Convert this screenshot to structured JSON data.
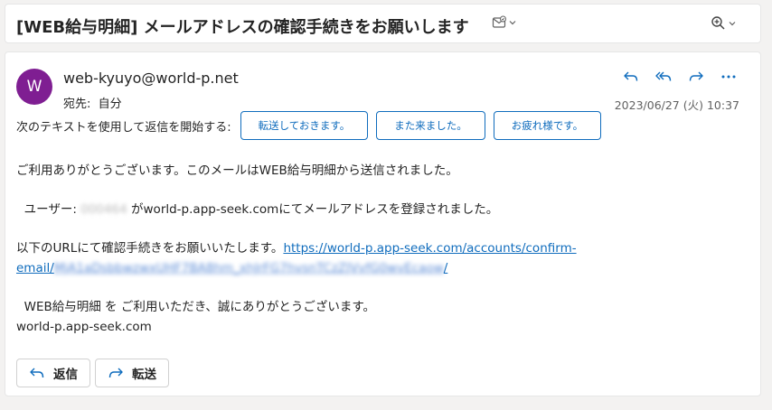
{
  "subject": {
    "title": "[WEB給与明細] メールアドレスの確認手続きをお願いします",
    "icons": [
      "mail-check-icon",
      "zoom-icon"
    ]
  },
  "message": {
    "avatar_letter": "W",
    "sender": "web-kyuyo@world-p.net",
    "to_label": "宛先:",
    "to_value": "自分",
    "date": "2023/06/27 (火) 10:37",
    "actions": [
      "reply-icon",
      "reply-all-icon",
      "forward-icon",
      "more-icon"
    ],
    "suggest_label": "次のテキストを使用して返信を開始する:",
    "suggestions": [
      "転送しておきます。",
      "また来ました。",
      "お疲れ様です。"
    ]
  },
  "body": {
    "line1": "ご利用ありがとうございます。このメールはWEB給与明細から送信されました。",
    "user_prefix": "ユーザー:",
    "user_id": "000464",
    "user_suffix": "がworld-p.app-seek.comにてメールアドレスを登録されました。",
    "url_prefix": "以下のURLにて確認手続きをお願いいたします。",
    "url_visible_1": "https://world-p.app-seek.com/accounts/confirm-",
    "url_visible_2": "email/",
    "url_token": "MjA1aDsbbwzwxUHF7BA8hm_xhJrFG7hvsnTCzZJVvfG0wvEcaow",
    "url_tail": "/",
    "thanks": "WEB給与明細 を ご利用いただき、誠にありがとうございます。",
    "site": "world-p.app-seek.com"
  },
  "buttons": {
    "reply_label": "返信",
    "forward_label": "転送"
  }
}
